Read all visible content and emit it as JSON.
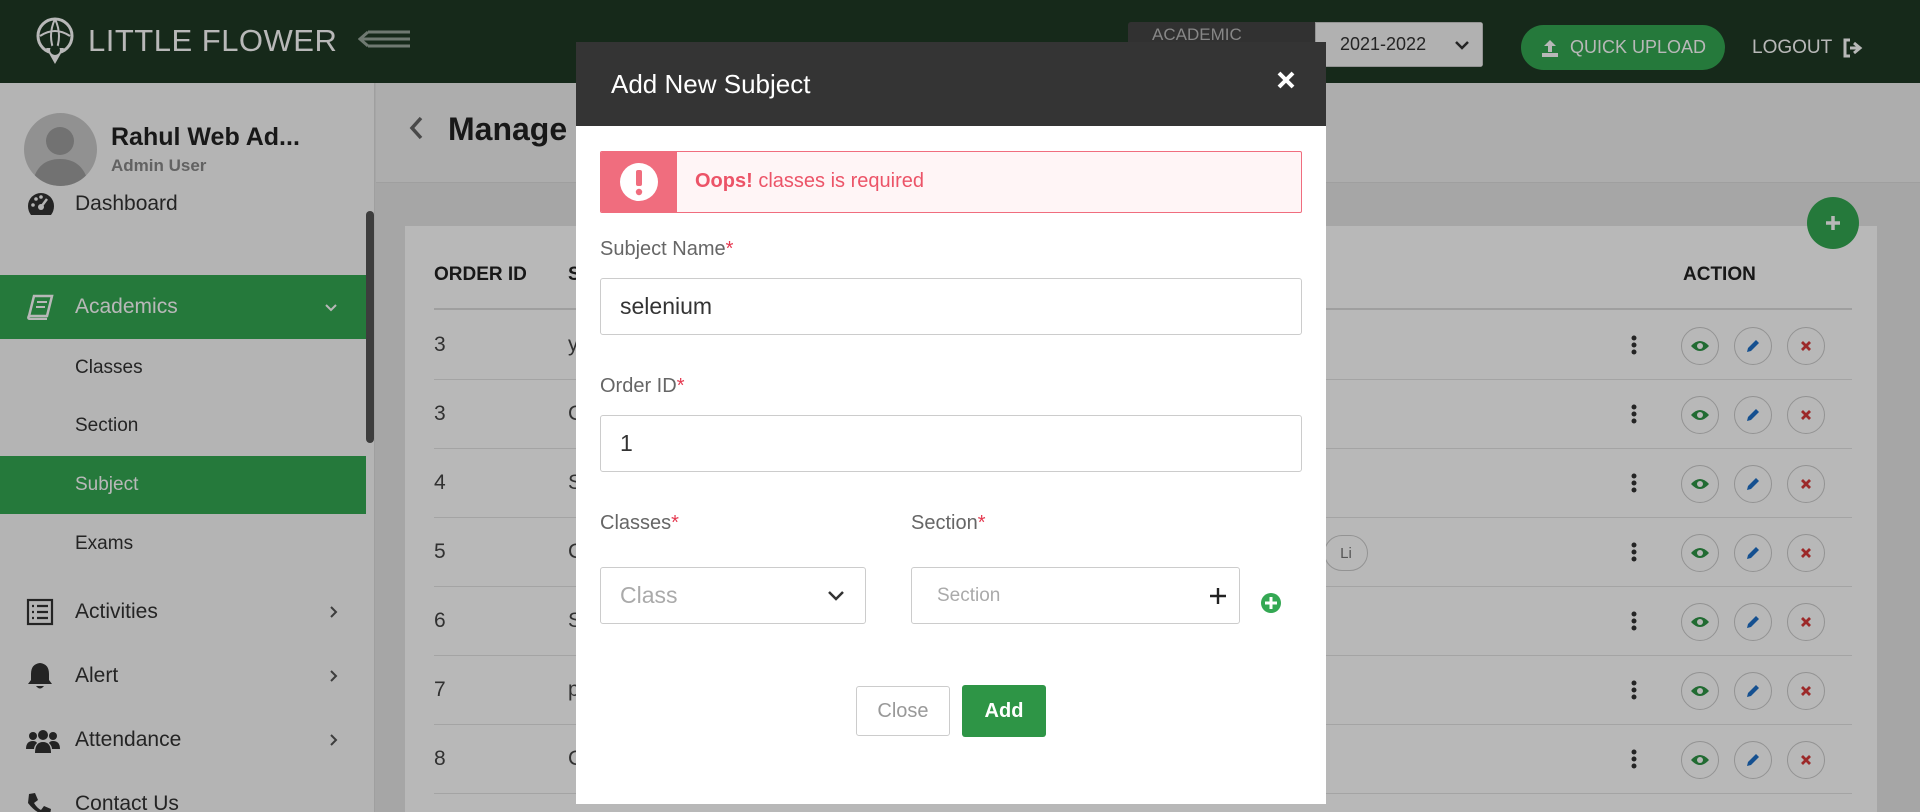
{
  "app": {
    "logo_text": "LITTLE FLOWER"
  },
  "header": {
    "academic_year_label": "ACADEMIC YEAR",
    "academic_year_value": "2021-2022",
    "quick_upload_label": "QUICK UPLOAD",
    "logout_label": "LOGOUT"
  },
  "user": {
    "name": "Rahul Web Ad...",
    "role": "Admin User"
  },
  "sidebar": {
    "items": [
      {
        "label": "Dashboard"
      },
      {
        "label": "Academics"
      },
      {
        "label": "Activities"
      },
      {
        "label": "Alert"
      },
      {
        "label": "Attendance"
      },
      {
        "label": "Contact Us"
      }
    ],
    "sub_items": [
      {
        "label": "Classes"
      },
      {
        "label": "Section"
      },
      {
        "label": "Subject"
      },
      {
        "label": "Exams"
      }
    ]
  },
  "page": {
    "title": "Manage"
  },
  "table": {
    "headers": {
      "order_id": "ORDER ID",
      "subject": "S",
      "action": "ACTION"
    },
    "rows": [
      {
        "order_id": "3",
        "name": "y"
      },
      {
        "order_id": "3",
        "name": "C"
      },
      {
        "order_id": "4",
        "name": "S"
      },
      {
        "order_id": "5",
        "name": "C",
        "chip": "Li"
      },
      {
        "order_id": "6",
        "name": "S"
      },
      {
        "order_id": "7",
        "name": "p"
      },
      {
        "order_id": "8",
        "name": "C"
      }
    ]
  },
  "modal": {
    "title": "Add New Subject",
    "alert": {
      "strong": "Oops!",
      "message": "classes is required"
    },
    "subject_name": {
      "label": "Subject Name",
      "value": "selenium"
    },
    "order_id": {
      "label": "Order ID",
      "value": "1"
    },
    "classes": {
      "label": "Classes",
      "placeholder": "Class"
    },
    "section": {
      "label": "Section",
      "placeholder": "Section"
    },
    "required_mark": "*",
    "close_label": "Close",
    "add_label": "Add"
  },
  "colors": {
    "brand_green": "#34a853",
    "topbar": "#1f3a25",
    "error": "#f06d7e"
  }
}
